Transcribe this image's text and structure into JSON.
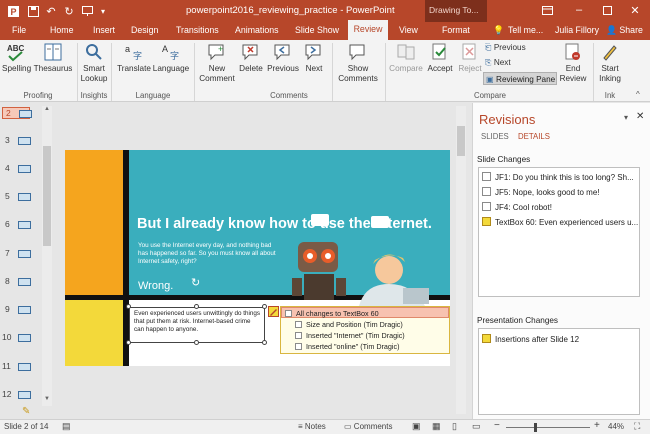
{
  "titlebar": {
    "title": "powerpoint2016_reviewing_practice - PowerPoint",
    "context_tab": "Drawing To...",
    "tell_me": "Tell me...",
    "user": "Julia Fillory",
    "share": "Share"
  },
  "tabs": [
    "File",
    "Home",
    "Insert",
    "Design",
    "Transitions",
    "Animations",
    "Slide Show",
    "Review",
    "View",
    "Format"
  ],
  "ribbon": {
    "proofing": {
      "spelling": "Spelling",
      "thesaurus": "Thesaurus",
      "group": "Proofing"
    },
    "insights": {
      "smart1": "Smart",
      "smart2": "Lookup",
      "group": "Insights"
    },
    "language": {
      "translate": "Translate",
      "language": "Language",
      "group": "Language"
    },
    "comments": {
      "new1": "New",
      "new2": "Comment",
      "delete": "Delete",
      "previous": "Previous",
      "next": "Next",
      "show1": "Show",
      "show2": "Comments",
      "group": "Comments"
    },
    "compare": {
      "compare": "Compare",
      "accept": "Accept",
      "reject": "Reject",
      "previous": "Previous",
      "next": "Next",
      "reviewing_pane": "Reviewing Pane",
      "end1": "End",
      "end2": "Review",
      "group": "Compare"
    },
    "ink": {
      "start1": "Start",
      "start2": "Inking",
      "group": "Ink"
    }
  },
  "thumbnails": [
    "2",
    "3",
    "4",
    "5",
    "6",
    "7",
    "8",
    "9",
    "10",
    "11",
    "12"
  ],
  "slide": {
    "headline": "But I already know how to use the Internet.",
    "body": "You use the Internet every day, and nothing bad has happened so far. So you must know all about Internet safety, right?",
    "wrong": "Wrong.",
    "textbox": "Even experienced users unwittingly do things that put them at risk. Internet-based crime can happen to anyone.",
    "popup": {
      "header": "All changes to TextBox 60",
      "items": [
        "Size and Position (Tim Dragic)",
        "Inserted \"Internet\" (Tim Dragic)",
        "Inserted \"online\" (Tim Dragic)"
      ]
    }
  },
  "pane": {
    "title": "Revisions",
    "tab_slides": "SLIDES",
    "tab_details": "DETAILS",
    "slide_changes_label": "Slide Changes",
    "slide_changes": [
      "JF1: Do you think this is too long? Sh...",
      "JF5: Nope, looks good to me!",
      "JF4: Cool robot!",
      "TextBox 60: Even experienced users u..."
    ],
    "presentation_changes_label": "Presentation Changes",
    "presentation_changes": [
      "Insertions after Slide 12"
    ]
  },
  "status": {
    "slide_info": "Slide 2 of 14",
    "notes": "Notes",
    "comments": "Comments",
    "zoom": "44%"
  },
  "colors": {
    "accent": "#b7472a",
    "slide_teal": "#3aaebd",
    "slide_orange": "#f5a51e",
    "slide_yellow": "#f3d93a"
  }
}
